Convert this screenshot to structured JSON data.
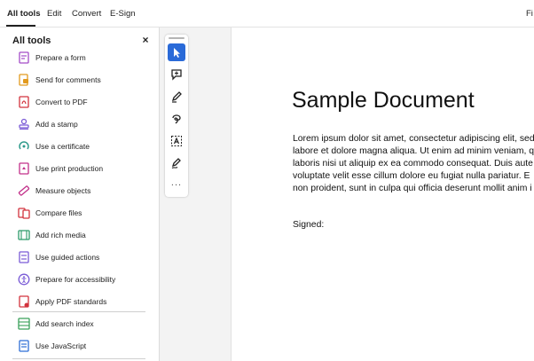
{
  "menubar": {
    "items": [
      {
        "label": "All tools",
        "active": true
      },
      {
        "label": "Edit"
      },
      {
        "label": "Convert"
      },
      {
        "label": "E-Sign"
      }
    ],
    "right_truncated": "Fi"
  },
  "panel": {
    "title": "All tools",
    "close_glyph": "×",
    "tools": [
      {
        "label": "Prepare a form",
        "icon": "prepare-form-icon",
        "color": "#a34cc8"
      },
      {
        "label": "Send for comments",
        "icon": "send-comments-icon",
        "color": "#e29a1e"
      },
      {
        "label": "Convert to PDF",
        "icon": "convert-pdf-icon",
        "color": "#d2333d"
      },
      {
        "label": "Add a stamp",
        "icon": "stamp-icon",
        "color": "#7a5bd6"
      },
      {
        "label": "Use a certificate",
        "icon": "certificate-icon",
        "color": "#2c9a8a"
      },
      {
        "label": "Use print production",
        "icon": "print-production-icon",
        "color": "#c2308a"
      },
      {
        "label": "Measure objects",
        "icon": "measure-icon",
        "color": "#c2308a"
      },
      {
        "label": "Compare files",
        "icon": "compare-files-icon",
        "color": "#d2333d"
      },
      {
        "label": "Add rich media",
        "icon": "rich-media-icon",
        "color": "#2c9a6a"
      },
      {
        "label": "Use guided actions",
        "icon": "guided-actions-icon",
        "color": "#7a5bd6"
      },
      {
        "label": "Prepare for accessibility",
        "icon": "accessibility-icon",
        "color": "#7a5bd6"
      },
      {
        "label": "Apply PDF standards",
        "icon": "pdf-standards-icon",
        "color": "#d2333d"
      },
      {
        "label": "Add search index",
        "icon": "search-index-icon",
        "color": "#3aa05a"
      },
      {
        "label": "Use JavaScript",
        "icon": "javascript-icon",
        "color": "#2f6fd6"
      }
    ]
  },
  "rail": {
    "buttons": [
      {
        "icon": "select-cursor-icon",
        "selected": true
      },
      {
        "icon": "add-comment-icon"
      },
      {
        "icon": "highlight-pen-icon"
      },
      {
        "icon": "draw-freeform-icon"
      },
      {
        "icon": "add-text-icon"
      },
      {
        "icon": "fill-sign-icon"
      }
    ],
    "more": "..."
  },
  "document": {
    "title": "Sample Document",
    "paragraph_lines": [
      "Lorem ipsum dolor sit amet, consectetur adipiscing elit, sed",
      "labore et dolore magna aliqua. Ut enim ad minim veniam, q",
      "laboris nisi ut aliquip ex ea commodo consequat. Duis aute",
      "voluptate velit esse cillum dolore eu fugiat nulla pariatur. E",
      "non proident, sunt in culpa qui officia deserunt mollit anim i"
    ],
    "signed": "Signed:"
  },
  "colors": {
    "selected_tool": "#2a6ad8",
    "rail_background": "#f3f3f3"
  }
}
